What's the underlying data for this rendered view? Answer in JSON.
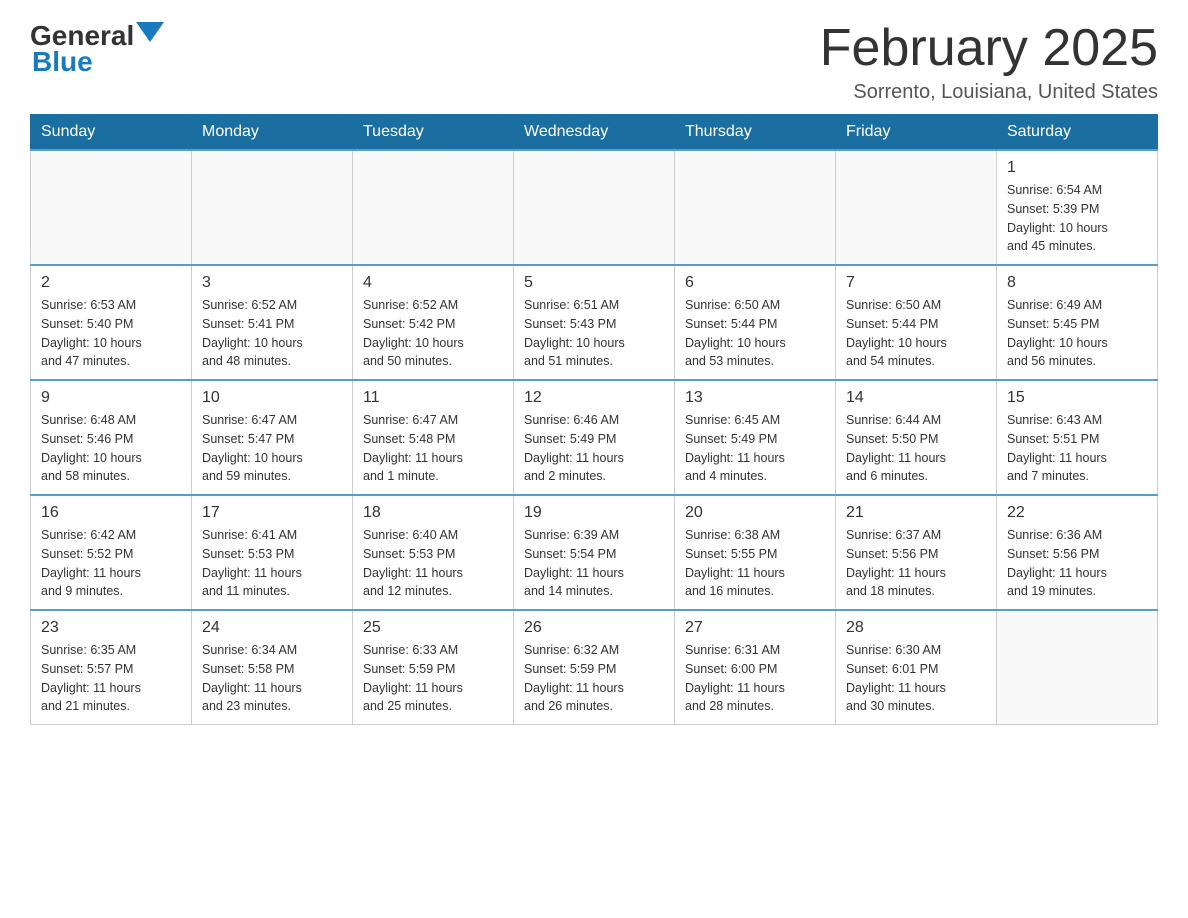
{
  "header": {
    "logo_general": "General",
    "logo_blue": "Blue",
    "month_title": "February 2025",
    "location": "Sorrento, Louisiana, United States"
  },
  "weekdays": [
    "Sunday",
    "Monday",
    "Tuesday",
    "Wednesday",
    "Thursday",
    "Friday",
    "Saturday"
  ],
  "weeks": [
    [
      {
        "day": "",
        "info": ""
      },
      {
        "day": "",
        "info": ""
      },
      {
        "day": "",
        "info": ""
      },
      {
        "day": "",
        "info": ""
      },
      {
        "day": "",
        "info": ""
      },
      {
        "day": "",
        "info": ""
      },
      {
        "day": "1",
        "info": "Sunrise: 6:54 AM\nSunset: 5:39 PM\nDaylight: 10 hours\nand 45 minutes."
      }
    ],
    [
      {
        "day": "2",
        "info": "Sunrise: 6:53 AM\nSunset: 5:40 PM\nDaylight: 10 hours\nand 47 minutes."
      },
      {
        "day": "3",
        "info": "Sunrise: 6:52 AM\nSunset: 5:41 PM\nDaylight: 10 hours\nand 48 minutes."
      },
      {
        "day": "4",
        "info": "Sunrise: 6:52 AM\nSunset: 5:42 PM\nDaylight: 10 hours\nand 50 minutes."
      },
      {
        "day": "5",
        "info": "Sunrise: 6:51 AM\nSunset: 5:43 PM\nDaylight: 10 hours\nand 51 minutes."
      },
      {
        "day": "6",
        "info": "Sunrise: 6:50 AM\nSunset: 5:44 PM\nDaylight: 10 hours\nand 53 minutes."
      },
      {
        "day": "7",
        "info": "Sunrise: 6:50 AM\nSunset: 5:44 PM\nDaylight: 10 hours\nand 54 minutes."
      },
      {
        "day": "8",
        "info": "Sunrise: 6:49 AM\nSunset: 5:45 PM\nDaylight: 10 hours\nand 56 minutes."
      }
    ],
    [
      {
        "day": "9",
        "info": "Sunrise: 6:48 AM\nSunset: 5:46 PM\nDaylight: 10 hours\nand 58 minutes."
      },
      {
        "day": "10",
        "info": "Sunrise: 6:47 AM\nSunset: 5:47 PM\nDaylight: 10 hours\nand 59 minutes."
      },
      {
        "day": "11",
        "info": "Sunrise: 6:47 AM\nSunset: 5:48 PM\nDaylight: 11 hours\nand 1 minute."
      },
      {
        "day": "12",
        "info": "Sunrise: 6:46 AM\nSunset: 5:49 PM\nDaylight: 11 hours\nand 2 minutes."
      },
      {
        "day": "13",
        "info": "Sunrise: 6:45 AM\nSunset: 5:49 PM\nDaylight: 11 hours\nand 4 minutes."
      },
      {
        "day": "14",
        "info": "Sunrise: 6:44 AM\nSunset: 5:50 PM\nDaylight: 11 hours\nand 6 minutes."
      },
      {
        "day": "15",
        "info": "Sunrise: 6:43 AM\nSunset: 5:51 PM\nDaylight: 11 hours\nand 7 minutes."
      }
    ],
    [
      {
        "day": "16",
        "info": "Sunrise: 6:42 AM\nSunset: 5:52 PM\nDaylight: 11 hours\nand 9 minutes."
      },
      {
        "day": "17",
        "info": "Sunrise: 6:41 AM\nSunset: 5:53 PM\nDaylight: 11 hours\nand 11 minutes."
      },
      {
        "day": "18",
        "info": "Sunrise: 6:40 AM\nSunset: 5:53 PM\nDaylight: 11 hours\nand 12 minutes."
      },
      {
        "day": "19",
        "info": "Sunrise: 6:39 AM\nSunset: 5:54 PM\nDaylight: 11 hours\nand 14 minutes."
      },
      {
        "day": "20",
        "info": "Sunrise: 6:38 AM\nSunset: 5:55 PM\nDaylight: 11 hours\nand 16 minutes."
      },
      {
        "day": "21",
        "info": "Sunrise: 6:37 AM\nSunset: 5:56 PM\nDaylight: 11 hours\nand 18 minutes."
      },
      {
        "day": "22",
        "info": "Sunrise: 6:36 AM\nSunset: 5:56 PM\nDaylight: 11 hours\nand 19 minutes."
      }
    ],
    [
      {
        "day": "23",
        "info": "Sunrise: 6:35 AM\nSunset: 5:57 PM\nDaylight: 11 hours\nand 21 minutes."
      },
      {
        "day": "24",
        "info": "Sunrise: 6:34 AM\nSunset: 5:58 PM\nDaylight: 11 hours\nand 23 minutes."
      },
      {
        "day": "25",
        "info": "Sunrise: 6:33 AM\nSunset: 5:59 PM\nDaylight: 11 hours\nand 25 minutes."
      },
      {
        "day": "26",
        "info": "Sunrise: 6:32 AM\nSunset: 5:59 PM\nDaylight: 11 hours\nand 26 minutes."
      },
      {
        "day": "27",
        "info": "Sunrise: 6:31 AM\nSunset: 6:00 PM\nDaylight: 11 hours\nand 28 minutes."
      },
      {
        "day": "28",
        "info": "Sunrise: 6:30 AM\nSunset: 6:01 PM\nDaylight: 11 hours\nand 30 minutes."
      },
      {
        "day": "",
        "info": ""
      }
    ]
  ]
}
